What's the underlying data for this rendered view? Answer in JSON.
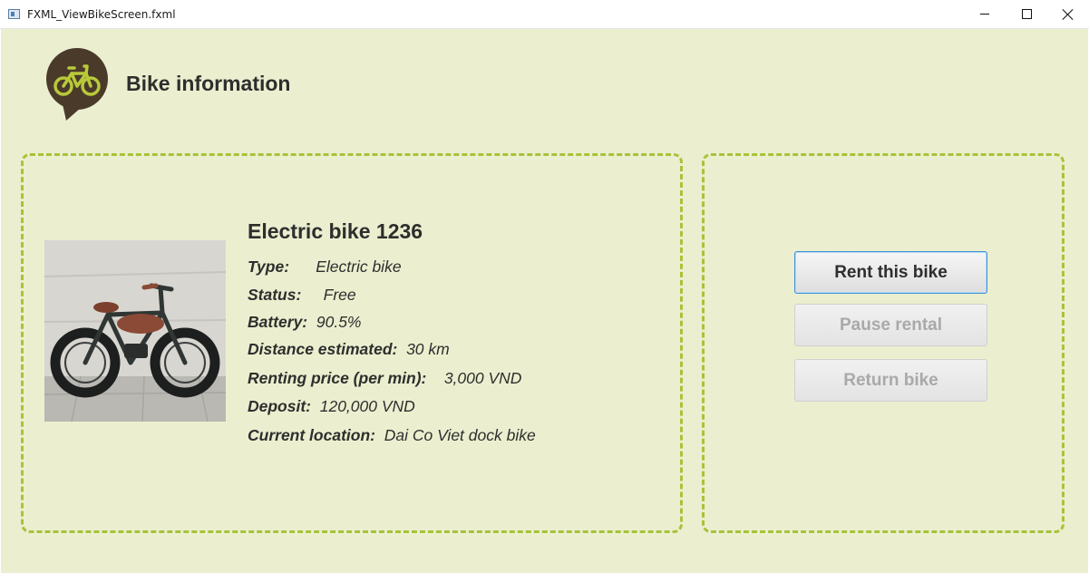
{
  "window": {
    "title": "FXML_ViewBikeScreen.fxml"
  },
  "header": {
    "title": "Bike information",
    "logo_icon": "bike-logo-icon"
  },
  "bike": {
    "name": "Electric bike 1236",
    "details": [
      {
        "label": "Type:",
        "value": "Electric bike"
      },
      {
        "label": "Status:",
        "value": "Free"
      },
      {
        "label": "Battery:",
        "value": "90.5%"
      },
      {
        "label": "Distance estimated:",
        "value": "30 km"
      },
      {
        "label": "Renting price (per min):",
        "value": "3,000 VND"
      },
      {
        "label": "Deposit:",
        "value": "120,000 VND"
      },
      {
        "label": "Current location:",
        "value": "Dai Co Viet dock bike"
      }
    ]
  },
  "actions": {
    "rent_label": "Rent this bike",
    "pause_label": "Pause rental",
    "return_label": "Return bike"
  },
  "colors": {
    "background": "#ebefcf",
    "accent": "#a9c23a",
    "logo_dark": "#4a3a2a",
    "logo_bike": "#b8c93a"
  }
}
